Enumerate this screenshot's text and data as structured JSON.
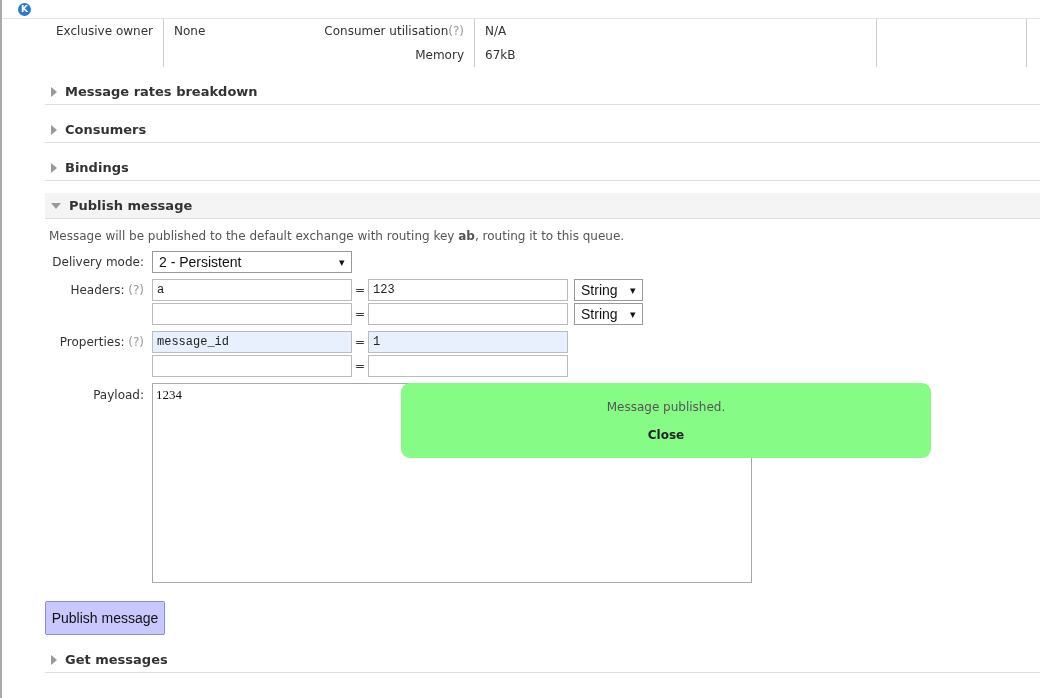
{
  "browser": {
    "logo": "K"
  },
  "overview": {
    "rows": [
      {
        "left": {
          "label": "Exclusive owner",
          "value": "None"
        },
        "right": {
          "label": "Consumer utilisation",
          "help": "(?)",
          "value": "N/A"
        }
      },
      {
        "right": {
          "label": "Memory",
          "value": "67kB"
        }
      }
    ]
  },
  "sections_before": [
    {
      "title": "Message rates breakdown",
      "expanded": false
    },
    {
      "title": "Consumers",
      "expanded": false
    },
    {
      "title": "Bindings",
      "expanded": false
    }
  ],
  "publish": {
    "title": "Publish message",
    "expanded": true,
    "intro": "Message will be published to the default exchange with routing key **ab**, routing it to this queue.",
    "delivery_mode": {
      "label": "Delivery mode:",
      "value": "2 - Persistent",
      "caret": "▾"
    },
    "headers": {
      "label": "Headers:",
      "help": "(?)",
      "rows": [
        {
          "key": "a",
          "separator": "=",
          "value": "123",
          "type": "String",
          "caret": "▾",
          "highlighted": false
        },
        {
          "separator": "=",
          "type": "String",
          "caret": "▾",
          "highlighted": false
        }
      ]
    },
    "properties": {
      "label": "Properties:",
      "help": "(?)",
      "rows": [
        {
          "key": "message_id",
          "separator": "=",
          "value": "1",
          "highlighted": true
        },
        {
          "separator": "=",
          "highlighted": false
        }
      ]
    },
    "payload": {
      "label": "Payload:",
      "value": "1234"
    },
    "button": "Publish message"
  },
  "toast": {
    "message": "Message published.",
    "close": "Close"
  },
  "sections_after": [
    {
      "title": "Get messages",
      "expanded": false
    }
  ]
}
